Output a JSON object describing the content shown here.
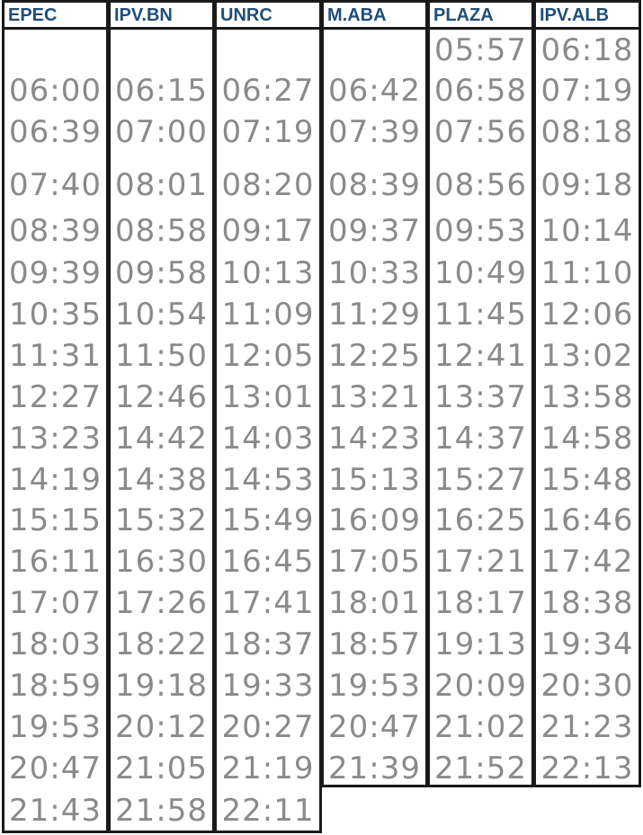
{
  "timetable": {
    "columns": [
      {
        "id": "epec",
        "header": "EPEC",
        "times": [
          "",
          "06:00",
          "06:39",
          "07:40",
          "08:39",
          "09:39",
          "10:35",
          "11:31",
          "12:27",
          "13:23",
          "14:19",
          "15:15",
          "16:11",
          "17:07",
          "18:03",
          "18:59",
          "19:53",
          "20:47",
          "21:43"
        ]
      },
      {
        "id": "ipv-bn",
        "header": "IPV.BN",
        "times": [
          "",
          "06:15",
          "07:00",
          "08:01",
          "08:58",
          "09:58",
          "10:54",
          "11:50",
          "12:46",
          "14:42",
          "14:38",
          "15:32",
          "16:30",
          "17:26",
          "18:22",
          "19:18",
          "20:12",
          "21:05",
          "21:58"
        ]
      },
      {
        "id": "unrc",
        "header": "UNRC",
        "times": [
          "",
          "06:27",
          "07:19",
          "08:20",
          "09:17",
          "10:13",
          "11:09",
          "12:05",
          "13:01",
          "14:03",
          "14:53",
          "15:49",
          "16:45",
          "17:41",
          "18:37",
          "19:33",
          "20:27",
          "21:19",
          "22:11"
        ]
      },
      {
        "id": "m-aba",
        "header": "M.ABA",
        "times": [
          "",
          "06:42",
          "07:39",
          "08:39",
          "09:37",
          "10:33",
          "11:29",
          "12:25",
          "13:21",
          "14:23",
          "15:13",
          "16:09",
          "17:05",
          "18:01",
          "18:57",
          "19:53",
          "20:47",
          "21:39"
        ]
      },
      {
        "id": "plaza",
        "header": "PLAZA",
        "times": [
          "05:57",
          "06:58",
          "07:56",
          "08:56",
          "09:53",
          "10:49",
          "11:45",
          "12:41",
          "13:37",
          "14:37",
          "15:27",
          "16:25",
          "17:21",
          "18:17",
          "19:13",
          "20:09",
          "21:02",
          "21:52"
        ]
      },
      {
        "id": "ipv-alb",
        "header": "IPV.ALB",
        "times": [
          "06:18",
          "07:19",
          "08:18",
          "09:18",
          "10:14",
          "11:10",
          "12:06",
          "13:02",
          "13:58",
          "14:58",
          "15:48",
          "16:46",
          "17:42",
          "18:38",
          "19:34",
          "20:30",
          "21:23",
          "22:13"
        ]
      }
    ],
    "colors": {
      "header_text": "#1f4e79",
      "time_text": "#8a8a8a",
      "border": "#1a1a1a",
      "background": "#ffffff"
    }
  }
}
